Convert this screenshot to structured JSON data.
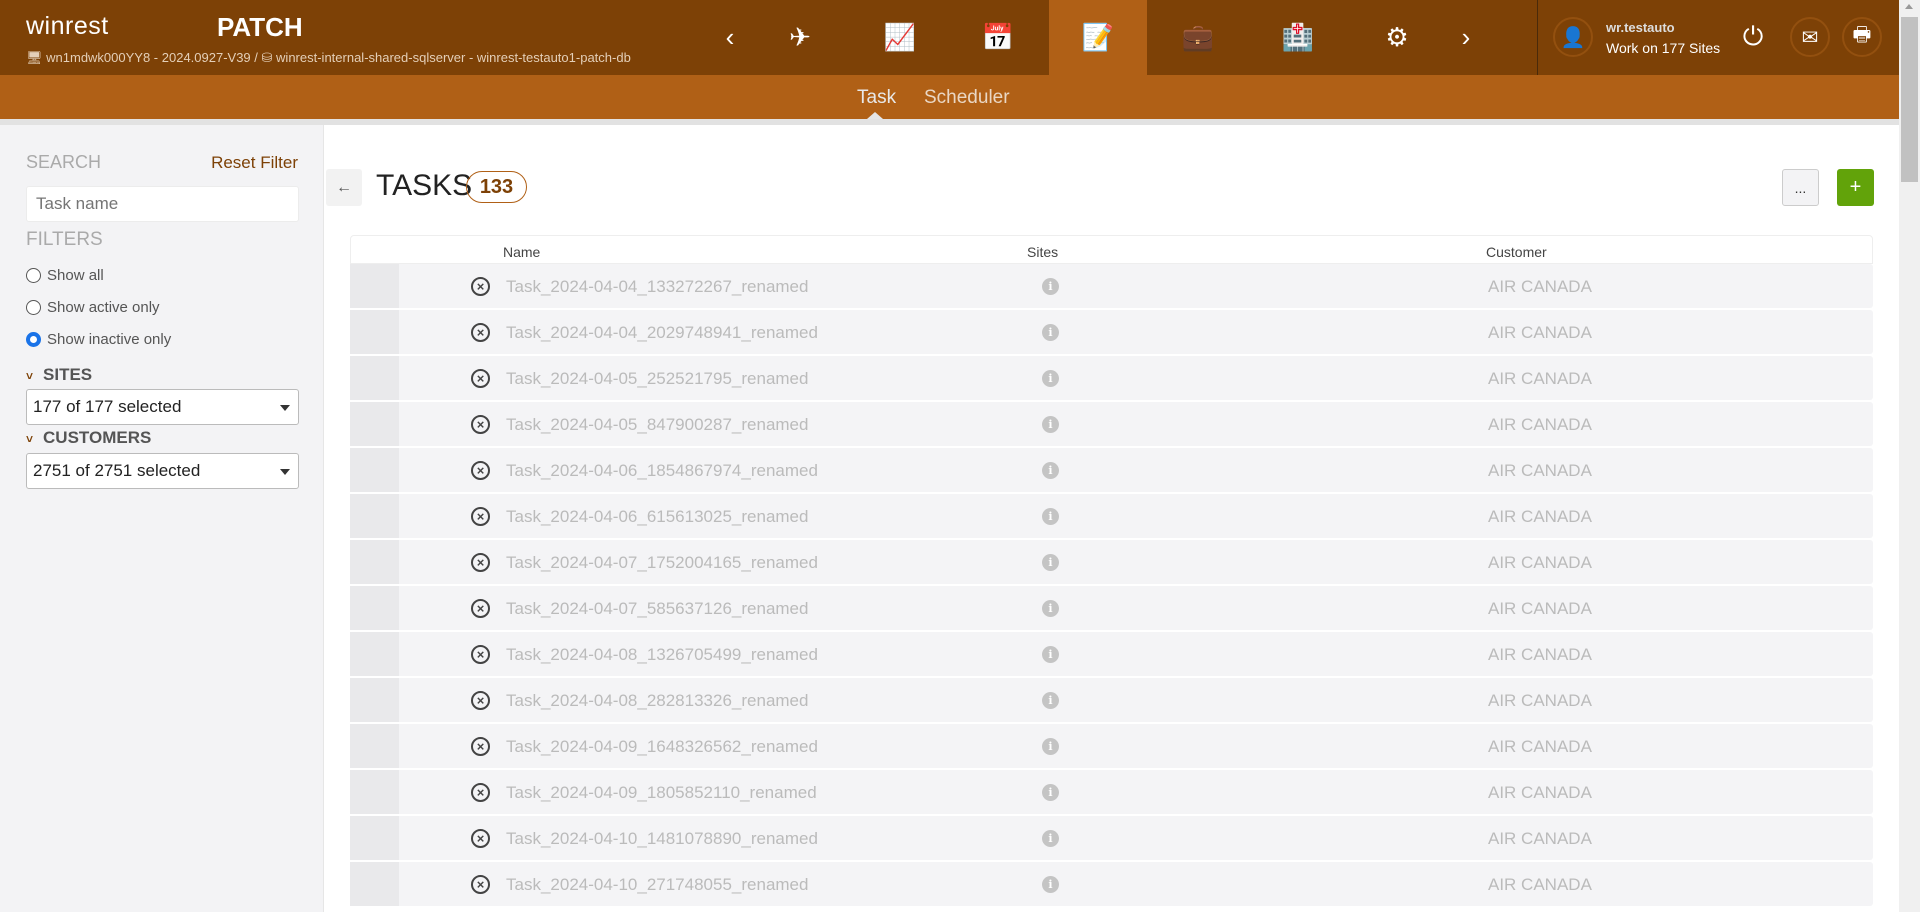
{
  "header": {
    "logo": "winrest",
    "app": "PATCH",
    "machine": "wn1mdwk000YY8 - 2024.0927-V39 /",
    "database": "winrest-internal-shared-sqlserver - winrest-testauto1-patch-db",
    "nav_icons": [
      "chevron-left-icon",
      "plane-icon",
      "chart-icon",
      "calendar-gear-icon",
      "clipboard-edit-icon",
      "briefcase-icon",
      "building-icon",
      "gear-icon",
      "chevron-right-icon"
    ],
    "active_nav": "clipboard-edit-icon",
    "user": {
      "name": "wr.testauto",
      "sites": "Work on 177 Sites"
    }
  },
  "subnav": {
    "tabs": [
      "Task",
      "Scheduler"
    ],
    "active": "Task"
  },
  "sidebar": {
    "search_label": "SEARCH",
    "reset": "Reset Filter",
    "search_placeholder": "Task name",
    "filters_label": "FILTERS",
    "radios": [
      "Show all",
      "Show active only",
      "Show inactive only"
    ],
    "selected_radio": "Show inactive only",
    "sites_label": "SITES",
    "sites_value": "177 of 177 selected",
    "customers_label": "CUSTOMERS",
    "customers_value": "2751 of 2751 selected"
  },
  "main": {
    "title": "TASKS",
    "count": "133",
    "more": "...",
    "add": "+",
    "columns": [
      "Name",
      "Sites",
      "Customer"
    ],
    "rows": [
      {
        "name": "Task_2024-04-04_133272267_renamed",
        "customer": "AIR CANADA"
      },
      {
        "name": "Task_2024-04-04_2029748941_renamed",
        "customer": "AIR CANADA"
      },
      {
        "name": "Task_2024-04-05_252521795_renamed",
        "customer": "AIR CANADA"
      },
      {
        "name": "Task_2024-04-05_847900287_renamed",
        "customer": "AIR CANADA"
      },
      {
        "name": "Task_2024-04-06_1854867974_renamed",
        "customer": "AIR CANADA"
      },
      {
        "name": "Task_2024-04-06_615613025_renamed",
        "customer": "AIR CANADA"
      },
      {
        "name": "Task_2024-04-07_1752004165_renamed",
        "customer": "AIR CANADA"
      },
      {
        "name": "Task_2024-04-07_585637126_renamed",
        "customer": "AIR CANADA"
      },
      {
        "name": "Task_2024-04-08_1326705499_renamed",
        "customer": "AIR CANADA"
      },
      {
        "name": "Task_2024-04-08_282813326_renamed",
        "customer": "AIR CANADA"
      },
      {
        "name": "Task_2024-04-09_1648326562_renamed",
        "customer": "AIR CANADA"
      },
      {
        "name": "Task_2024-04-09_1805852110_renamed",
        "customer": "AIR CANADA"
      },
      {
        "name": "Task_2024-04-10_1481078890_renamed",
        "customer": "AIR CANADA"
      },
      {
        "name": "Task_2024-04-10_271748055_renamed",
        "customer": "AIR CANADA"
      }
    ]
  }
}
